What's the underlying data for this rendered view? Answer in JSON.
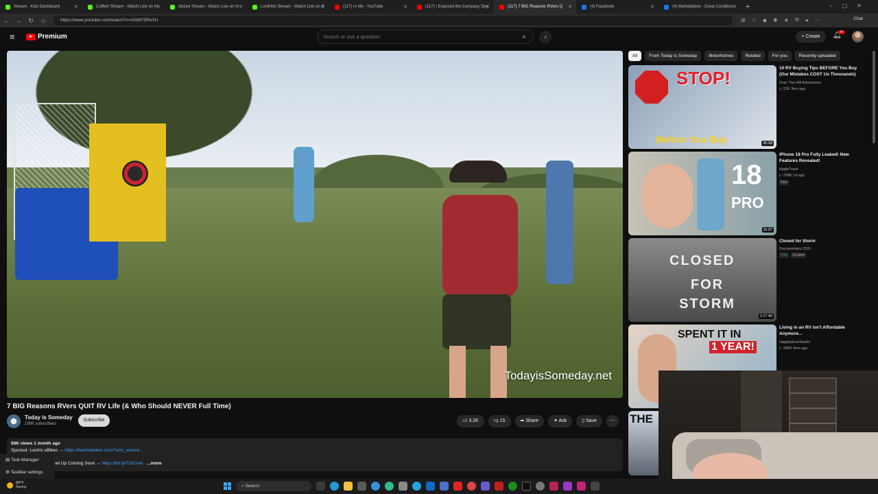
{
  "browser": {
    "tabs": [
      {
        "title": "Stream - Kick Dashboard",
        "color": "#53fc18",
        "active": false
      },
      {
        "title": "Cuffem Stream - Watch Live on Ki",
        "color": "#53fc18",
        "active": false
      },
      {
        "title": "kibzee Stream - Watch Live on Ki",
        "color": "#53fc18",
        "active": false
      },
      {
        "title": "LordHito Stream - Watch Live on K",
        "color": "#53fc18",
        "active": false
      },
      {
        "title": "(117) rv life - YouTube",
        "color": "#ff0000",
        "active": false
      },
      {
        "title": "(117) I Exposed the Company Spy",
        "color": "#ff0000",
        "active": false
      },
      {
        "title": "(117) 7 BIG Reasons RVers Q",
        "color": "#ff0000",
        "active": true
      },
      {
        "title": "(4) Facebook",
        "color": "#1877f2",
        "active": false
      },
      {
        "title": "(4) Marketplace - Great Condition",
        "color": "#1877f2",
        "active": false
      }
    ],
    "url": "https://www.youtube.com/watch?v=AXb8Y9PeXU",
    "chat_label": "Chat"
  },
  "youtube": {
    "logo_text": "Premium",
    "search_placeholder": "Search or ask a question",
    "create_label": "Create",
    "notif_count": "9+"
  },
  "video": {
    "watermark": "TodayisSomeday.net",
    "title": "7 BIG Reasons RVers QUIT RV Life (& Who Should NEVER Full Time)",
    "channel": "Today is Someday",
    "subscribers": "198K subscribers",
    "subscribe_label": "Subscribe",
    "likes": "3.2K",
    "dislikes": "15",
    "share": "Share",
    "ask": "Ask",
    "save": "Save",
    "views_date": "56K views  1 month ago",
    "sponsor_prefix": "Sponsor: Lectric eBikes → ",
    "sponsor_link": "https://lectricebikes.com/?utm_source...",
    "meetup_prefix": "eet Up Coming Soon → ",
    "meetup_link": "https://bit.ly/TISCrew",
    "more": "...more"
  },
  "context_menu": [
    "Task Manager",
    "Taskbar settings"
  ],
  "chips": [
    "All",
    "From Today is Someday",
    "Motorhomes",
    "Related",
    "For you",
    "Recently uploaded"
  ],
  "recommendations": [
    {
      "title": "10 RV Buying Tips BEFORE You Buy (Our Mistakes COST Us Thousands)",
      "channel": "Over The Hill Adventures",
      "meta": "22K  3mo ago",
      "duration": "35:39",
      "thumb_text_top": "STOP!",
      "thumb_text_bottom": "Before You Buy"
    },
    {
      "title": "iPhone 18 Pro Fully Leaked! New Features Revealed!",
      "channel": "AppleTrack",
      "meta": "258K  1d ago",
      "badge": "New",
      "duration": "11:37",
      "thumb_text_top": "18",
      "thumb_text_bottom": "PRO"
    },
    {
      "title": "Closed for Storm",
      "channel": "Documentary 2021",
      "free": "Free",
      "rated": "Unrated",
      "duration": "1:17:49",
      "thumb_text_top": "CLOSED",
      "thumb_text_bottom": "FOR STORM"
    },
    {
      "title": "Living in an RV Isn't Affordable Anymore...",
      "channel": "HappilyEverHanks",
      "meta": "395K  4mo ago",
      "thumb_text_top": "SPENT IT IN",
      "thumb_text_bottom": "1 YEAR!"
    }
  ],
  "partial_thumb_text": "THE",
  "taskbar": {
    "temp": "68°F",
    "condition": "Sunny",
    "search": "Search"
  }
}
